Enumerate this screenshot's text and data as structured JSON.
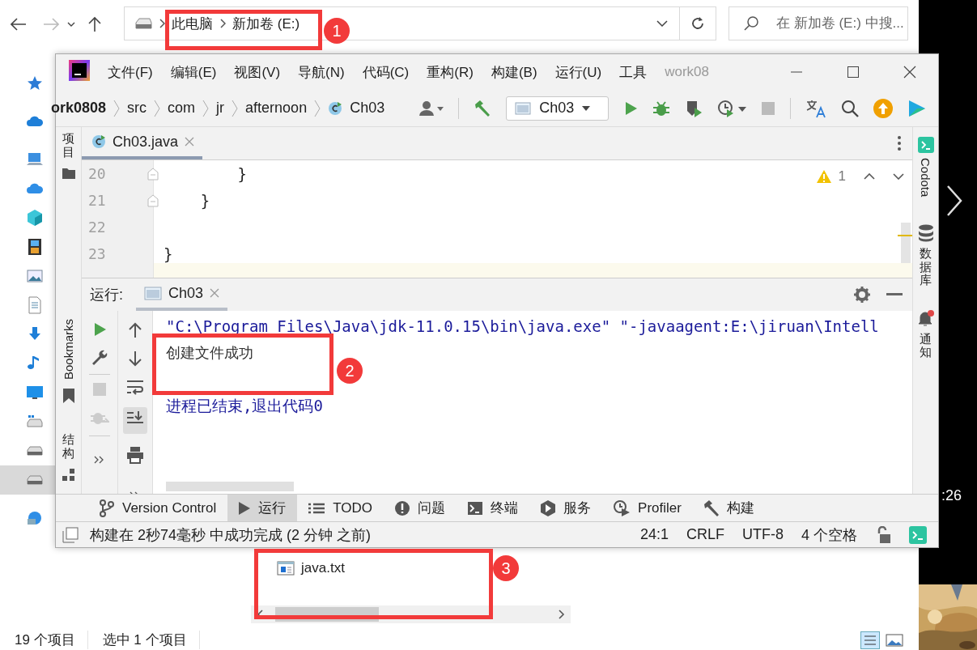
{
  "explorer": {
    "address": {
      "crumbs": [
        "此电脑",
        "新加卷 (E:)"
      ]
    },
    "search": {
      "placeholder": "在 新加卷 (E:) 中搜..."
    },
    "nav_items": [
      {
        "selected": false
      },
      {
        "selected": false
      },
      {
        "selected": false
      },
      {
        "selected": false
      },
      {
        "selected": false
      },
      {
        "selected": false
      },
      {
        "selected": false
      },
      {
        "selected": false
      },
      {
        "selected": false
      },
      {
        "selected": false
      },
      {
        "selected": false
      },
      {
        "selected": false
      },
      {
        "selected": false
      },
      {
        "selected": true
      },
      {
        "selected": false
      }
    ],
    "files": [
      {
        "name": "java.txt"
      }
    ],
    "status": [
      "19 个项目",
      "选中 1 个项目"
    ]
  },
  "ide": {
    "menu": [
      "文件(F)",
      "编辑(E)",
      "视图(V)",
      "导航(N)",
      "代码(C)",
      "重构(R)",
      "构建(B)",
      "运行(U)",
      "工具"
    ],
    "project_title": "work08",
    "breadcrumbs": [
      "ork0808",
      "src",
      "com",
      "jr",
      "afternoon",
      "Ch03"
    ],
    "run_config": "Ch03",
    "left_stripe": {
      "top": "项目",
      "bottom": [
        "Bookmarks",
        "结构"
      ]
    },
    "right_stripe": [
      "Codota",
      "数据库",
      "通知"
    ],
    "editor_tabs": [
      {
        "label": "Ch03.java",
        "selected": true
      }
    ],
    "editor": {
      "warnings": "1",
      "lines": [
        {
          "number": "20",
          "code": "        }"
        },
        {
          "number": "21",
          "code": "    }"
        },
        {
          "number": "22"
        },
        {
          "number": "23",
          "code": "}"
        }
      ]
    },
    "run_panel": {
      "title": "运行:",
      "tabs": [
        {
          "label": "Ch03",
          "selected": true
        }
      ],
      "output": [
        {
          "kind": "command",
          "text": "\"C:\\Program Files\\Java\\jdk-11.0.15\\bin\\java.exe\" \"-javaagent:E:\\jiruan\\Intell"
        },
        {
          "kind": "stdout",
          "text": "创建文件成功"
        },
        {
          "kind": "blank"
        },
        {
          "kind": "exit",
          "text": "进程已结束,退出代码0"
        }
      ]
    },
    "tool_tabs": [
      {
        "label": "Version Control",
        "selected": false
      },
      {
        "label": "运行",
        "selected": true
      },
      {
        "label": "TODO",
        "selected": false
      },
      {
        "label": "问题",
        "selected": false
      },
      {
        "label": "终端",
        "selected": false
      },
      {
        "label": "服务",
        "selected": false
      },
      {
        "label": "Profiler",
        "selected": false
      },
      {
        "label": "构建",
        "selected": false
      }
    ],
    "status": {
      "message": "构建在 2秒74毫秒 中成功完成 (2 分钟 之前)",
      "items": [
        "24:1",
        "CRLF",
        "UTF-8",
        "4 个空格"
      ]
    }
  },
  "annotations": [
    {
      "number": "1"
    },
    {
      "number": "2"
    },
    {
      "number": "3"
    }
  ],
  "desktop": {
    "clock": ":26"
  }
}
